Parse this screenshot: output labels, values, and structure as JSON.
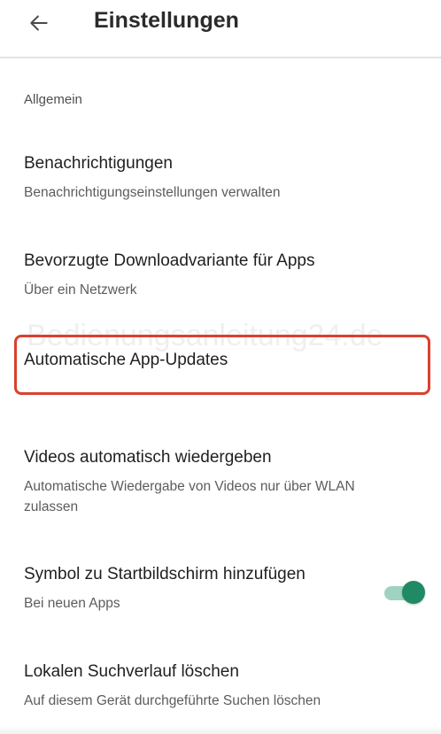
{
  "header": {
    "title": "Einstellungen",
    "back_icon": "arrow-left-icon"
  },
  "section": {
    "label": "Allgemein"
  },
  "items": [
    {
      "title": "Benachrichtigungen",
      "subtitle": "Benachrichtigungseinstellungen verwalten"
    },
    {
      "title": "Bevorzugte Downloadvariante für Apps",
      "subtitle": "Über ein Netzwerk"
    },
    {
      "title": "Automatische App-Updates",
      "subtitle": ""
    },
    {
      "title": "Videos automatisch wiedergeben",
      "subtitle": "Automatische Wiedergabe von Videos nur über WLAN zulassen"
    },
    {
      "title": "Symbol zu Startbildschirm hinzufügen",
      "subtitle": "Bei neuen Apps",
      "toggle_on": true
    },
    {
      "title": "Lokalen Suchverlauf löschen",
      "subtitle": "Auf diesem Gerät durchgeführte Suchen löschen"
    }
  ],
  "watermark": "Bedienungsanleitung24.de",
  "colors": {
    "highlight": "#d9412e",
    "toggle_thumb": "#1f8a63",
    "toggle_track": "#9fd3c1"
  }
}
